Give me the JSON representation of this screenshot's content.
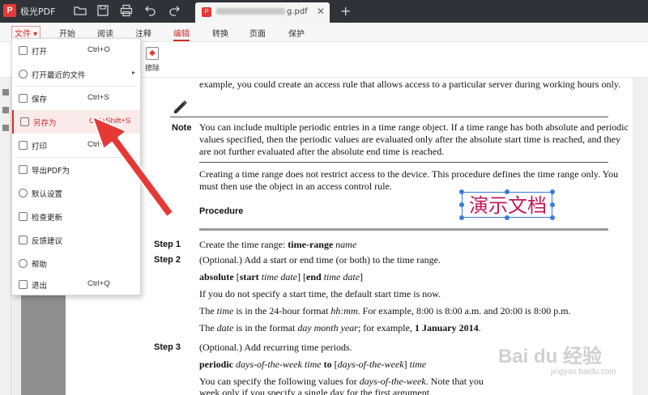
{
  "app": {
    "title": "极光PDF",
    "logo_glyph": "P"
  },
  "tab": {
    "badge": "P",
    "filename_suffix": "g.pdf",
    "close": "✕",
    "add": "+"
  },
  "menubar": {
    "file": "文件",
    "items": [
      "开始",
      "阅读",
      "注释",
      "编辑",
      "转换",
      "页面",
      "保护"
    ],
    "active_index": 3
  },
  "toolbar": {
    "erase_label": "擦除"
  },
  "dropdown": {
    "items": [
      {
        "label": "打开",
        "shortcut": "Ctrl+O"
      },
      {
        "label": "打开最近的文件",
        "shortcut": "",
        "submenu": "▸"
      },
      {
        "label": "保存",
        "shortcut": "Ctrl+S"
      },
      {
        "label": "另存为",
        "shortcut": "Ctrl+Shift+S"
      },
      {
        "label": "打印",
        "shortcut": "Ctrl+P"
      },
      {
        "label": "导出PDF为",
        "shortcut": ""
      },
      {
        "label": "默认设置",
        "shortcut": ""
      },
      {
        "label": "检查更新",
        "shortcut": ""
      },
      {
        "label": "反馈建议",
        "shortcut": ""
      },
      {
        "label": "帮助",
        "shortcut": ""
      },
      {
        "label": "退出",
        "shortcut": "Ctrl+Q"
      }
    ],
    "highlight_index": 3
  },
  "document": {
    "line0": "example, you could create an access rule that allows access to a particular server during working hours only.",
    "note_label": "Note",
    "note_lines": [
      "You can include multiple periodic entries in a time range object. If a time range has both absolute and periodic",
      "values specified, then the periodic values are evaluated only after the absolute start time is reached, and they",
      "are not further evaluated after the absolute end time is reached."
    ],
    "para_lines": [
      "Creating a time range does not restrict access to the device. This procedure defines the time range only. You",
      "must then use the object in an access control rule."
    ],
    "procedure": "Procedure",
    "step1": "Step 1",
    "step1_a": "Create the time range: ",
    "step1_b": "time-range",
    "step1_c": " name",
    "step2": "Step 2",
    "step2_text": "(Optional.) Add a start or end time (or both) to the time range.",
    "abs_a": "absolute",
    "abs_b": " [",
    "abs_c": "start",
    "abs_d": " time date",
    "abs_e": "] [",
    "abs_f": "end",
    "abs_g": " time date",
    "abs_h": "]",
    "start_line": "If you do not specify a start time, the default start time is now.",
    "time_a": "The ",
    "time_b": "time",
    "time_c": " is in the 24-hour format ",
    "time_d": "hh:mm",
    "time_e": ". For example, 8:00 is 8:00 a.m. and 20:00 is 8:00 p.m.",
    "date_a": "The ",
    "date_b": "date",
    "date_c": " is in the format ",
    "date_d": "day month year",
    "date_e": "; for example, ",
    "date_f": "1 January 2014",
    "date_g": ".",
    "step3": "Step 3",
    "step3_text": "(Optional.) Add recurring time periods.",
    "per_a": "periodic",
    "per_b": " days-of-the-week time",
    "per_c": " to",
    "per_d": " [",
    "per_e": "days-of-the-week",
    "per_f": "] ",
    "per_g": "time",
    "spec_a": "You can specify the following values for ",
    "spec_b": "days-of-the-week",
    "spec_c": ". Note that you",
    "last_line": "week only if you specify a single day for the first argument."
  },
  "annotation": {
    "text": "演示文档",
    "color": "#c2185b"
  },
  "watermark": {
    "main": "Bai du 经验",
    "sub": "jingyan.baidu.com"
  },
  "colors": {
    "accent": "#d32f2f",
    "titlebar": "#2f3338",
    "arrow": "#e53935"
  }
}
